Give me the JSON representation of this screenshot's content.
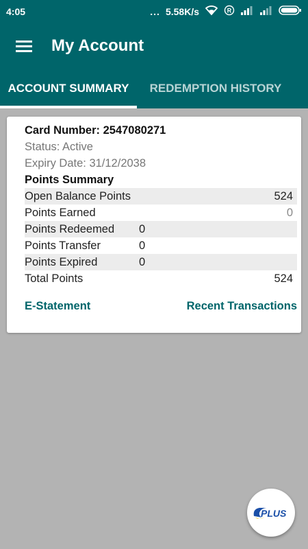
{
  "status_bar": {
    "time": "4:05",
    "dots": "...",
    "speed": "5.58K/s",
    "icons": [
      "wifi-icon",
      "registered-icon",
      "signal-icon",
      "signal-icon",
      "battery-icon"
    ]
  },
  "app_bar": {
    "title": "My Account",
    "menu_icon": "hamburger-menu-icon"
  },
  "tabs": [
    {
      "label": "ACCOUNT SUMMARY",
      "active": true
    },
    {
      "label": "REDEMPTION HISTORY",
      "active": false
    }
  ],
  "card": {
    "card_number": "Card Number: 2547080271",
    "status": "Status: Active",
    "expiry": "Expiry Date: 31/12/2038",
    "points_title": "Points Summary",
    "rows": [
      {
        "label": "Open Balance Points",
        "value": "524"
      },
      {
        "label": "Points Earned",
        "value": "0"
      },
      {
        "label": "Points Redeemed",
        "value": "0"
      },
      {
        "label": "Points Transfer",
        "value": "0"
      },
      {
        "label": "Points Expired",
        "value": "0"
      },
      {
        "label": "Total Points",
        "value": "524"
      }
    ],
    "links": {
      "estatement": "E-Statement",
      "recent": "Recent Transactions"
    }
  },
  "fab": {
    "logo_text": "PLUS",
    "icon": "plus-logo-icon"
  },
  "colors": {
    "primary": "#00656a",
    "background": "#b3b3b3"
  }
}
